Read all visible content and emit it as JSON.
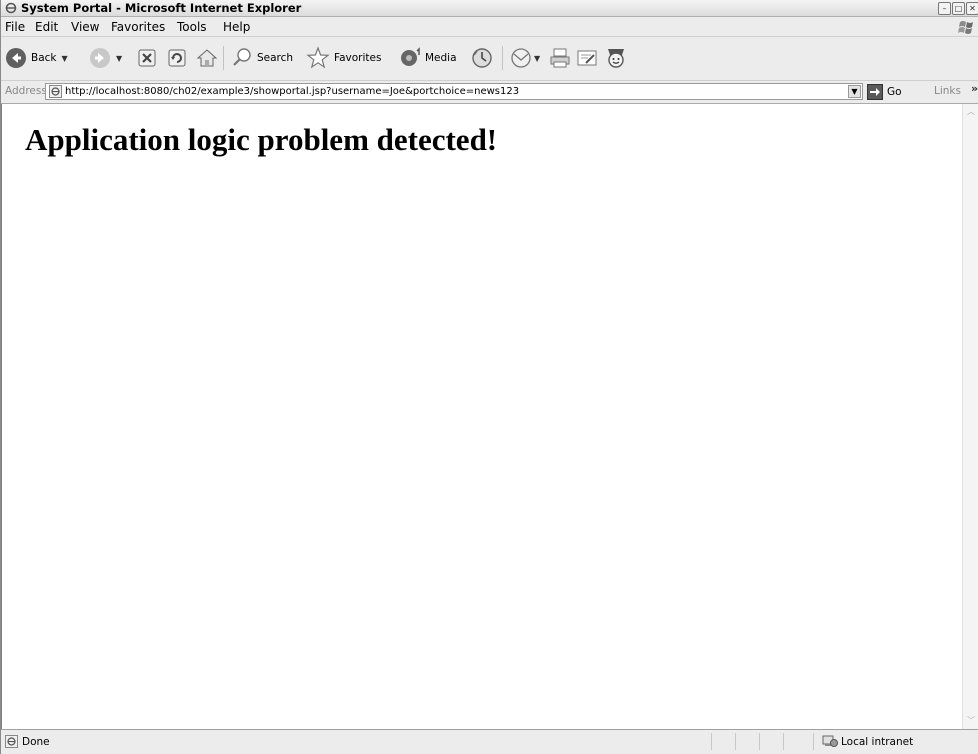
{
  "window": {
    "title": "System Portal - Microsoft Internet Explorer",
    "controls": [
      "minimize",
      "maximize",
      "close"
    ]
  },
  "menu": {
    "items": [
      "File",
      "Edit",
      "View",
      "Favorites",
      "Tools",
      "Help"
    ]
  },
  "toolbar": {
    "back_label": "Back",
    "search_label": "Search",
    "favorites_label": "Favorites",
    "media_label": "Media",
    "icons": [
      "back-icon",
      "forward-icon",
      "stop-icon",
      "refresh-icon",
      "home-icon",
      "search-icon",
      "favorites-star-icon",
      "media-icon",
      "history-icon",
      "mail-icon",
      "print-icon",
      "edit-icon",
      "messenger-icon"
    ]
  },
  "address": {
    "label": "Address",
    "url": "http://localhost:8080/ch02/example3/showportal.jsp?username=Joe&portchoice=news123",
    "go_label": "Go",
    "links_label": "Links"
  },
  "page": {
    "heading": "Application logic problem detected!"
  },
  "status": {
    "text": "Done",
    "zone": "Local intranet"
  }
}
